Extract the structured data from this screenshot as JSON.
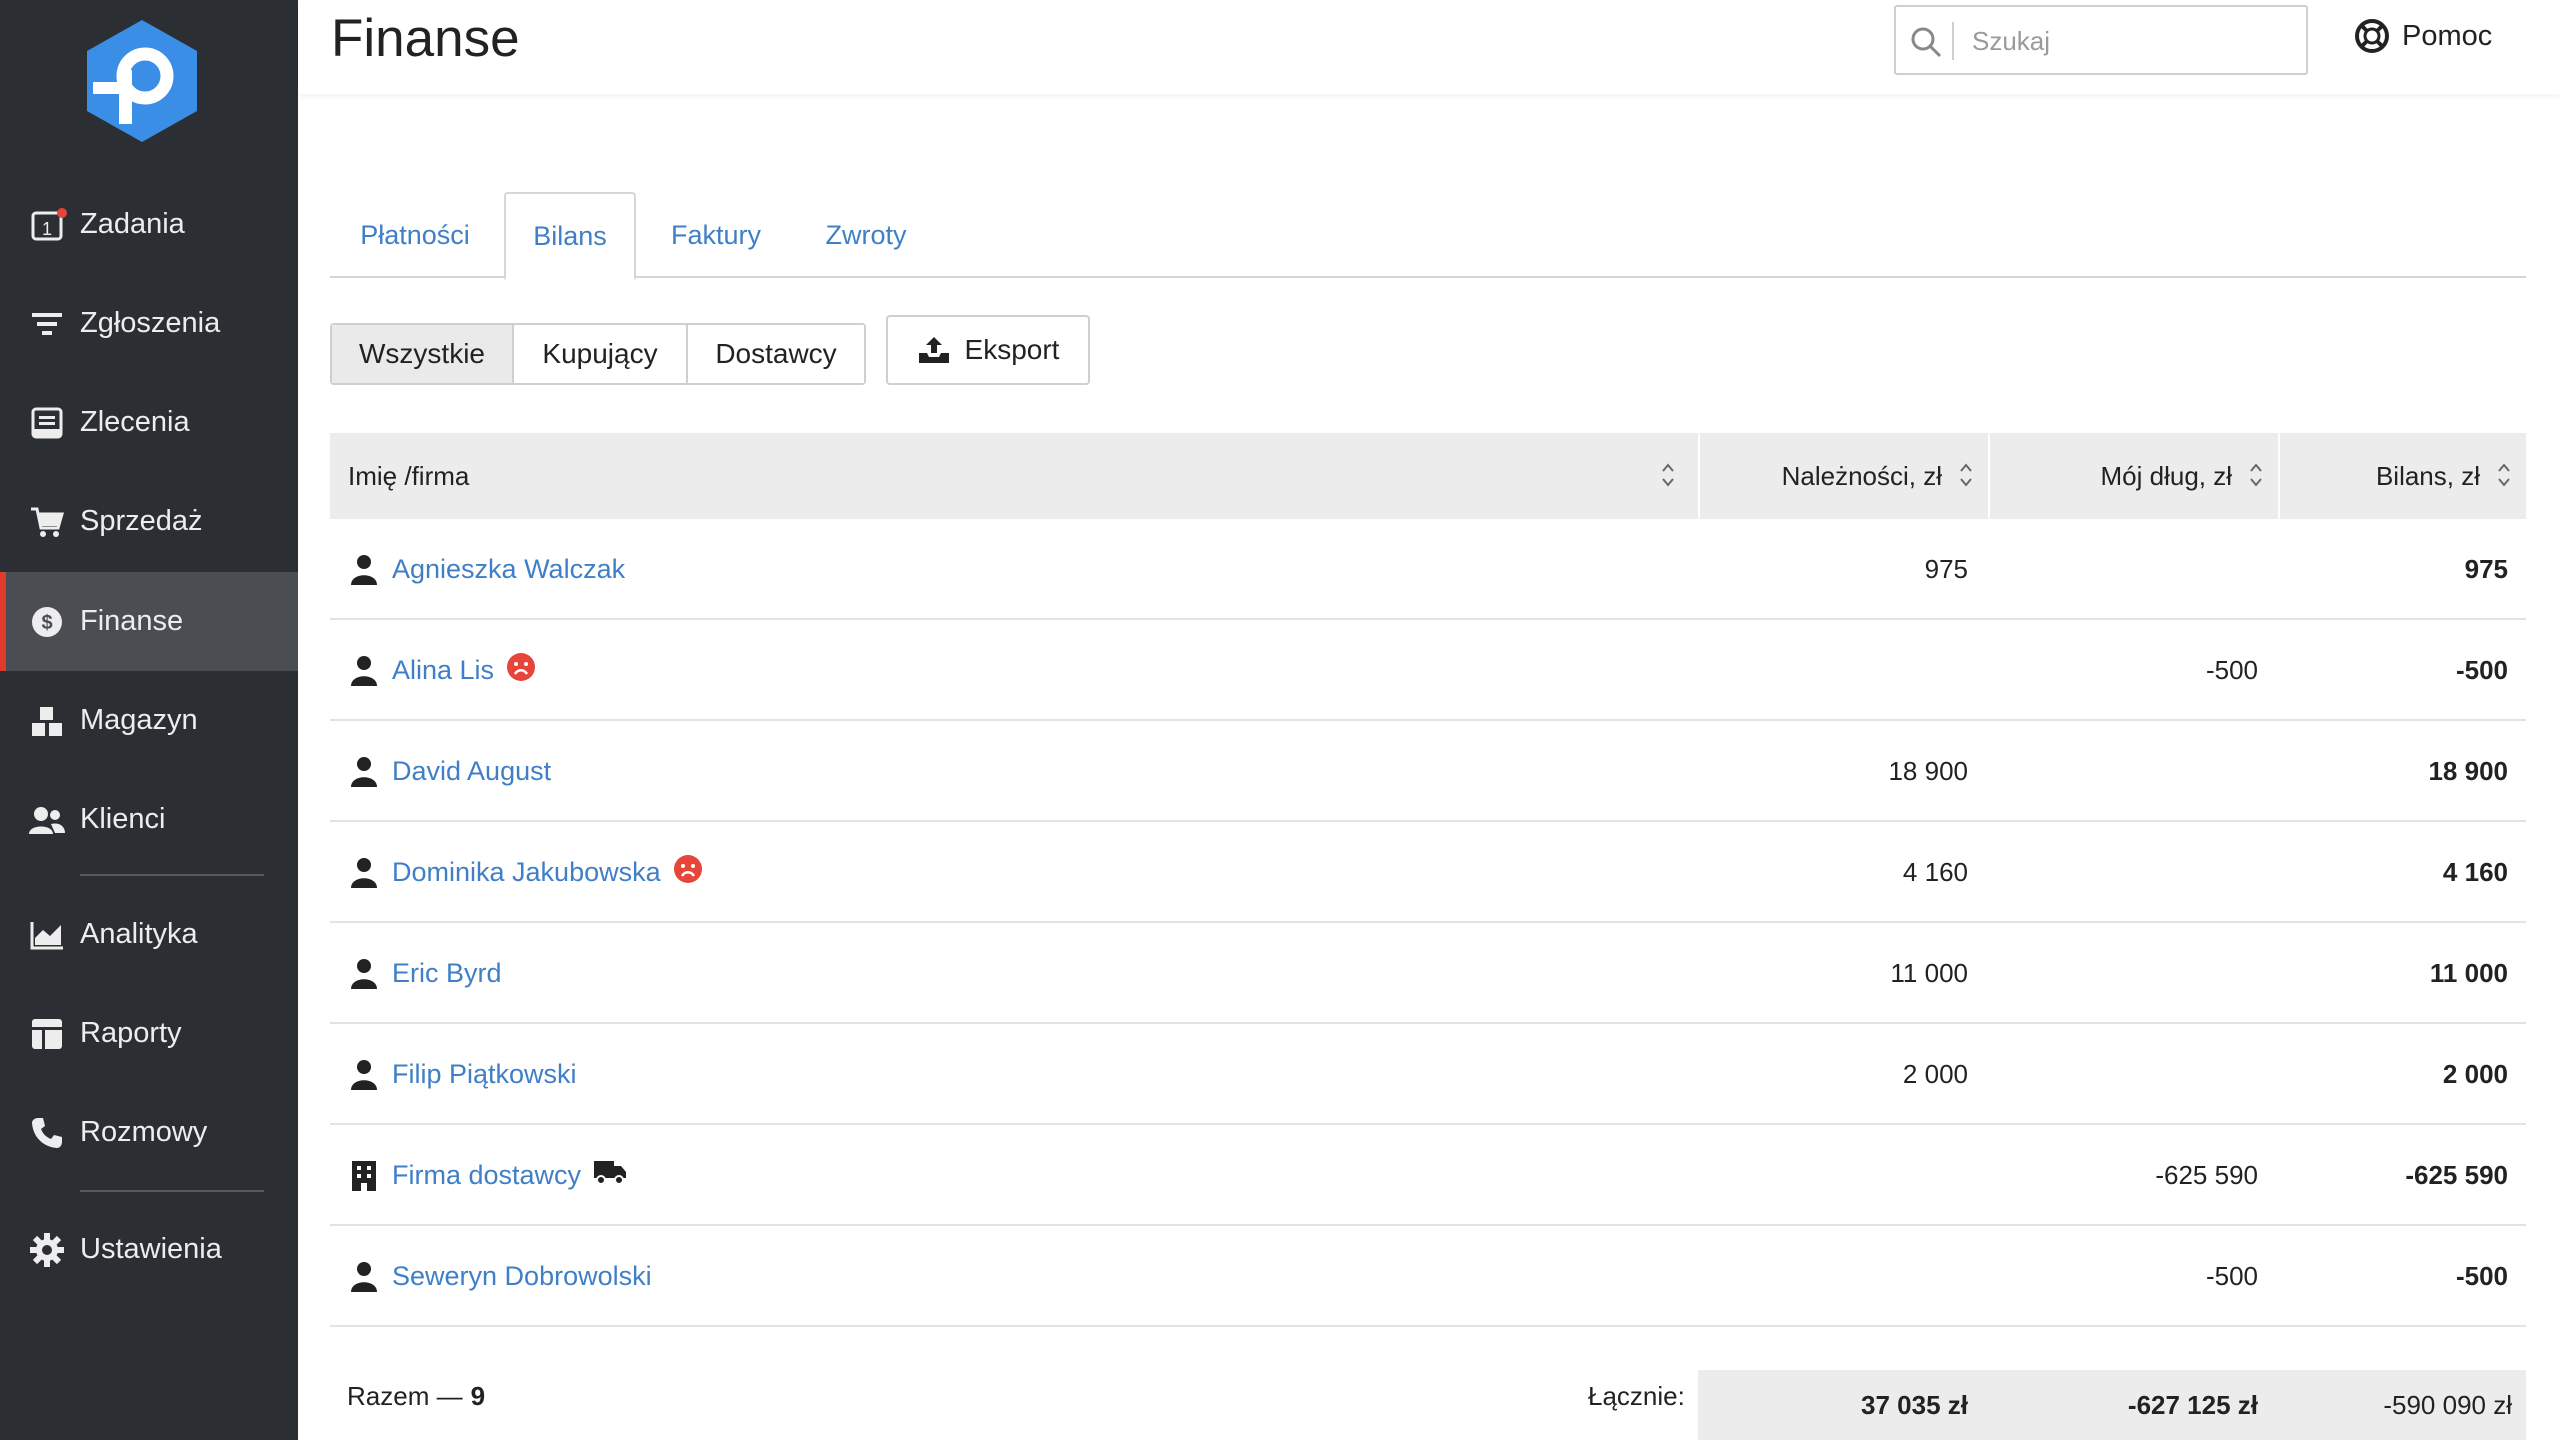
{
  "sidebar": {
    "items": [
      {
        "label": "Zadania",
        "icon": "tasks-icon",
        "badge": "1"
      },
      {
        "label": "Zgłoszenia",
        "icon": "filter-icon"
      },
      {
        "label": "Zlecenia",
        "icon": "orders-icon"
      },
      {
        "label": "Sprzedaż",
        "icon": "cart-icon"
      },
      {
        "label": "Finanse",
        "icon": "dollar-icon",
        "active": true
      },
      {
        "label": "Magazyn",
        "icon": "warehouse-icon"
      },
      {
        "label": "Klienci",
        "icon": "clients-icon"
      },
      {
        "label": "Analityka",
        "icon": "chart-area-icon"
      },
      {
        "label": "Raporty",
        "icon": "reports-icon"
      },
      {
        "label": "Rozmowy",
        "icon": "phone-icon"
      },
      {
        "label": "Ustawienia",
        "icon": "gear-icon"
      }
    ],
    "accent": "#e03b2f"
  },
  "header": {
    "title": "Finanse",
    "search_placeholder": "Szukaj",
    "help_label": "Pomoc"
  },
  "tabs": [
    {
      "label": "Płatności"
    },
    {
      "label": "Bilans",
      "active": true
    },
    {
      "label": "Faktury"
    },
    {
      "label": "Zwroty"
    }
  ],
  "filters": {
    "segments": [
      {
        "label": "Wszystkie",
        "active": true
      },
      {
        "label": "Kupujący"
      },
      {
        "label": "Dostawcy"
      }
    ],
    "export_label": "Eksport"
  },
  "table": {
    "columns": [
      "Imię /firma",
      "Należności, zł",
      "Mój dług, zł",
      "Bilans, zł"
    ],
    "rows": [
      {
        "name": "Agnieszka Walczak",
        "type": "person",
        "flag": "",
        "receivables": "975",
        "debt": "",
        "balance": "975",
        "sign": "pos"
      },
      {
        "name": "Alina Lis",
        "type": "person",
        "flag": "sad-face",
        "receivables": "",
        "debt": "-500",
        "balance": "-500",
        "sign": "neg"
      },
      {
        "name": "David August",
        "type": "person",
        "flag": "",
        "receivables": "18 900",
        "debt": "",
        "balance": "18 900",
        "sign": "pos"
      },
      {
        "name": "Dominika Jakubowska",
        "type": "person",
        "flag": "sad-face",
        "receivables": "4 160",
        "debt": "",
        "balance": "4 160",
        "sign": "pos"
      },
      {
        "name": "Eric Byrd",
        "type": "person",
        "flag": "",
        "receivables": "11 000",
        "debt": "",
        "balance": "11 000",
        "sign": "pos"
      },
      {
        "name": "Filip Piątkowski",
        "type": "person",
        "flag": "",
        "receivables": "2 000",
        "debt": "",
        "balance": "2 000",
        "sign": "pos"
      },
      {
        "name": "Firma dostawcy",
        "type": "company",
        "flag": "truck",
        "receivables": "",
        "debt": "-625 590",
        "balance": "-625 590",
        "sign": "neg"
      },
      {
        "name": "Seweryn Dobrowolski",
        "type": "person",
        "flag": "",
        "receivables": "",
        "debt": "-500",
        "balance": "-500",
        "sign": "neg"
      }
    ]
  },
  "footer": {
    "count_label": "Razem —",
    "count": "9",
    "sum_label": "Łącznie:",
    "receivables_total": "37 035 zł",
    "debt_total": "-627 125 zł",
    "balance_total": "-590 090 zł"
  },
  "colors": {
    "positive": "#4caf37",
    "negative": "#e03b2f",
    "link": "#3f7fc7",
    "sidebar_bg": "#2b2f33"
  }
}
